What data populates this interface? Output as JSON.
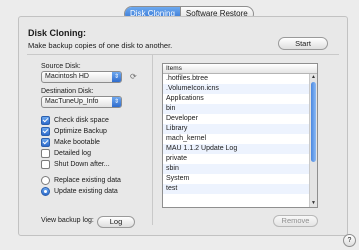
{
  "tabs": [
    {
      "label": "Disk Cloning",
      "active": true
    },
    {
      "label": "Software Restore",
      "active": false
    }
  ],
  "header": {
    "title": "Disk Cloning:",
    "description": "Make backup copies of one disk to another.",
    "start_label": "Start"
  },
  "source": {
    "label": "Source Disk:",
    "value": "Macintosh HD",
    "refresh_icon": "refresh-icon"
  },
  "destination": {
    "label": "Destination Disk:",
    "value": "MacTuneUp_Info"
  },
  "options": {
    "check_disk_space": {
      "label": "Check disk space",
      "checked": true
    },
    "optimize_backup": {
      "label": "Optimize Backup",
      "checked": true
    },
    "make_bootable": {
      "label": "Make bootable",
      "checked": true
    },
    "detailed_log": {
      "label": "Detailed log",
      "checked": false
    },
    "shut_down_after": {
      "label": "Shut Down after...",
      "checked": false
    }
  },
  "mode": {
    "replace": {
      "label": "Replace existing data",
      "selected": false
    },
    "update": {
      "label": "Update existing data",
      "selected": true
    }
  },
  "log": {
    "label": "View backup log:",
    "button": "Log"
  },
  "items": {
    "header": "Items",
    "rows": [
      ".hotfiles.btree",
      ".VolumeIcon.icns",
      "Applications",
      "bin",
      "Developer",
      "Library",
      "mach_kernel",
      "MAU 1.1.2 Update Log",
      "private",
      "sbin",
      "System",
      "test"
    ],
    "remove_label": "Remove"
  },
  "help_label": "?",
  "colors": {
    "accent": "#2f6fcf",
    "panel_bg": "#e8e8e8",
    "window_bg": "#ececec",
    "row_alt": "#edf3fe"
  }
}
